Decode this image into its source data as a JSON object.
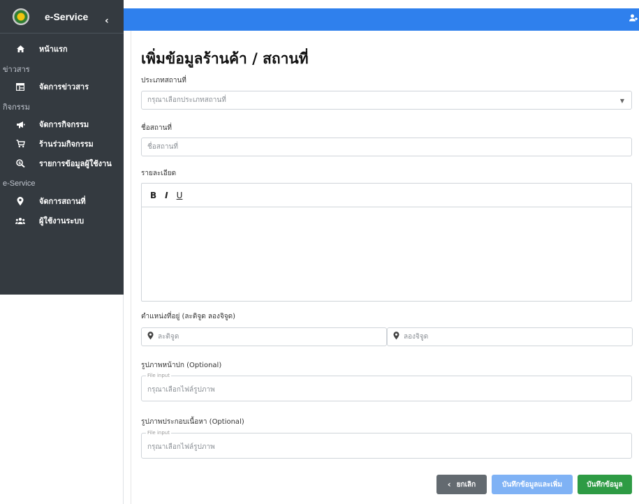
{
  "brand": {
    "name": "e-Service",
    "collapse": "‹"
  },
  "sidebar": {
    "home": {
      "label": "หน้าแรก"
    },
    "sections": [
      {
        "header": "ข่าวสาร",
        "items": [
          {
            "label": "จัดการข่าวสาร",
            "icon": "newspaper-icon"
          }
        ]
      },
      {
        "header": "กิจกรรม",
        "items": [
          {
            "label": "จัดการกิจกรรม",
            "icon": "megaphone-icon"
          },
          {
            "label": "ร้านร่วมกิจกรรม",
            "icon": "cart-icon"
          },
          {
            "label": "รายการข้อมูลผู้ใช้งาน",
            "icon": "search-dollar-icon"
          }
        ]
      },
      {
        "header": "e-Service",
        "items": [
          {
            "label": "จัดการสถานที่",
            "icon": "map-pin-icon"
          },
          {
            "label": "ผู้ใช้งานระบบ",
            "icon": "users-icon"
          }
        ]
      }
    ]
  },
  "topbar": {
    "user_icon": "user-icon"
  },
  "form": {
    "title": "เพิ่มข้อมูลร้านค้า / สถานที่",
    "place_type": {
      "label": "ประเภทสถานที่",
      "placeholder": "กรุณาเลือกประเภทสถานที่"
    },
    "place_name": {
      "label": "ชื่อสถานที่",
      "placeholder": "ชื่อสถานที่"
    },
    "details": {
      "label": "รายละเอียด",
      "toolbar": {
        "bold": "B",
        "italic": "I",
        "underline": "U"
      }
    },
    "location": {
      "label": "ตำแหน่งที่อยู่ (ละติจูด ลองจิจูด)",
      "lat_placeholder": "ละติจูด",
      "lng_placeholder": "ลองจิจูด"
    },
    "cover_image": {
      "label": "รูปภาพหน้าปก (Optional)",
      "legend": "File input",
      "placeholder": "กรุณาเลือกไฟล์รูปภาพ"
    },
    "content_images": {
      "label": "รูปภาพประกอบเนื้อหา (Optional)",
      "legend": "File input",
      "placeholder": "กรุณาเลือกไฟล์รูปภาพ"
    },
    "buttons": {
      "cancel": "ยกเลิก",
      "save_and_add": "บันทึกข้อมูลและเพิ่ม",
      "save": "บันทึกข้อมูล"
    }
  },
  "colors": {
    "sidebar": "#343a40",
    "topbar": "#2f80ed",
    "save": "#2e9b44",
    "save_and_add": "#7fb2f5",
    "cancel": "#636a70"
  }
}
